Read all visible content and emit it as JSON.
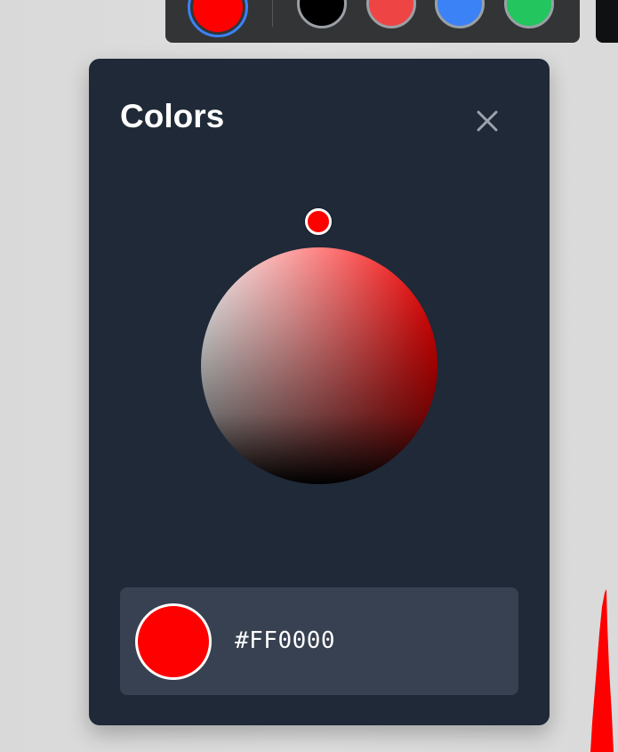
{
  "toolbar": {
    "swatches": [
      {
        "name": "red",
        "color": "#FF0000",
        "selected": true
      },
      {
        "name": "black",
        "color": "#000000",
        "selected": false
      },
      {
        "name": "light-red",
        "color": "#EF4444",
        "selected": false
      },
      {
        "name": "blue",
        "color": "#3B82F6",
        "selected": false
      },
      {
        "name": "green",
        "color": "#22C55E",
        "selected": false
      }
    ]
  },
  "panel": {
    "title": "Colors",
    "close_icon": "close-icon",
    "picker": {
      "hue_color": "#FF0000"
    },
    "current": {
      "color": "#FF0000",
      "hex": "#FF0000"
    }
  },
  "colors": {
    "accent": "#3B82F6",
    "panel_bg": "#1F2937",
    "bar_bg": "#374151"
  }
}
